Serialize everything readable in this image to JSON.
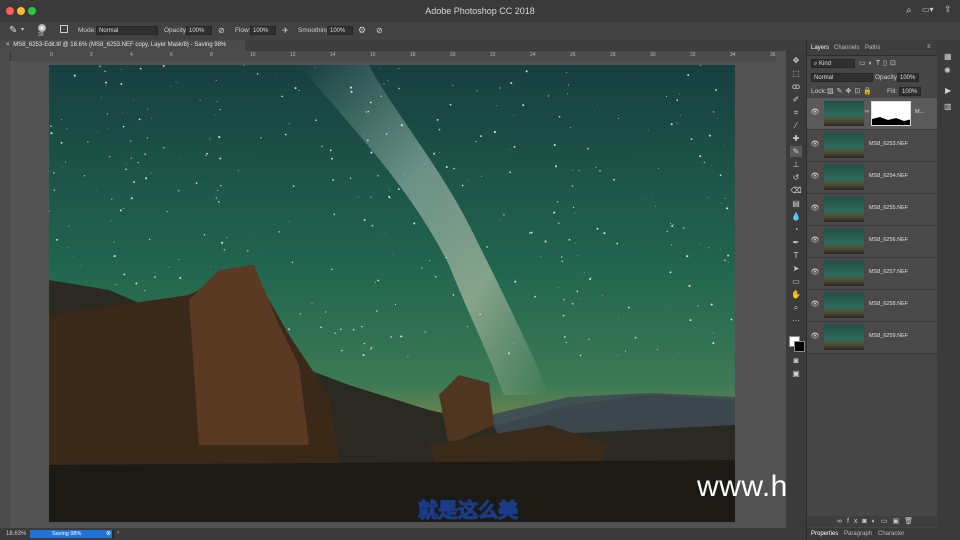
{
  "app": {
    "title": "Adobe Photoshop CC 2018"
  },
  "window_controls": {
    "close_color": "#fc5f57",
    "minimize_color": "#fdbc2e",
    "zoom_color": "#28c840"
  },
  "options_bar": {
    "brush_size": "39",
    "mode_label": "Mode:",
    "mode_value": "Normal",
    "opacity_label": "Opacity:",
    "opacity_value": "100%",
    "flow_label": "Flow:",
    "flow_value": "100%",
    "smoothing_label": "Smoothing:",
    "smoothing_value": "100%"
  },
  "document": {
    "tab_title": "MS8_6253-Edit.tif @ 18.6% (MS8_6253.NEF copy, Layer Mask/8) - Saving 98%",
    "close_glyph": "×"
  },
  "ruler": {
    "labels": [
      "0",
      "2",
      "4",
      "6",
      "8",
      "10",
      "12",
      "14",
      "16",
      "18",
      "20",
      "22",
      "24",
      "26",
      "28",
      "30",
      "32",
      "34",
      "36"
    ]
  },
  "status": {
    "zoom": "18.63%",
    "saving_text": "Saving 98%",
    "saving_progress": 0.98
  },
  "panels": {
    "tabs": [
      "Layers",
      "Channels",
      "Paths"
    ],
    "filter_label": "Kind",
    "blend_mode": "Normal",
    "opacity_label": "Opacity:",
    "opacity_value": "100%",
    "lock_label": "Lock:",
    "fill_label": "Fill:",
    "fill_value": "100%",
    "layers": [
      {
        "name": "M...",
        "has_mask": true
      },
      {
        "name": "MS8_6253.NEF"
      },
      {
        "name": "MS8_6254.NEF"
      },
      {
        "name": "MS8_6255.NEF"
      },
      {
        "name": "MS8_6256.NEF"
      },
      {
        "name": "MS8_6257.NEF"
      },
      {
        "name": "MS8_6258.NEF"
      },
      {
        "name": "MS8_6259.NEF"
      }
    ],
    "bottom_tabs": [
      "Properties",
      "Paragraph",
      "Character"
    ]
  },
  "overlay": {
    "watermark": "www.hunls.com",
    "subtitle": "就是这么美"
  }
}
